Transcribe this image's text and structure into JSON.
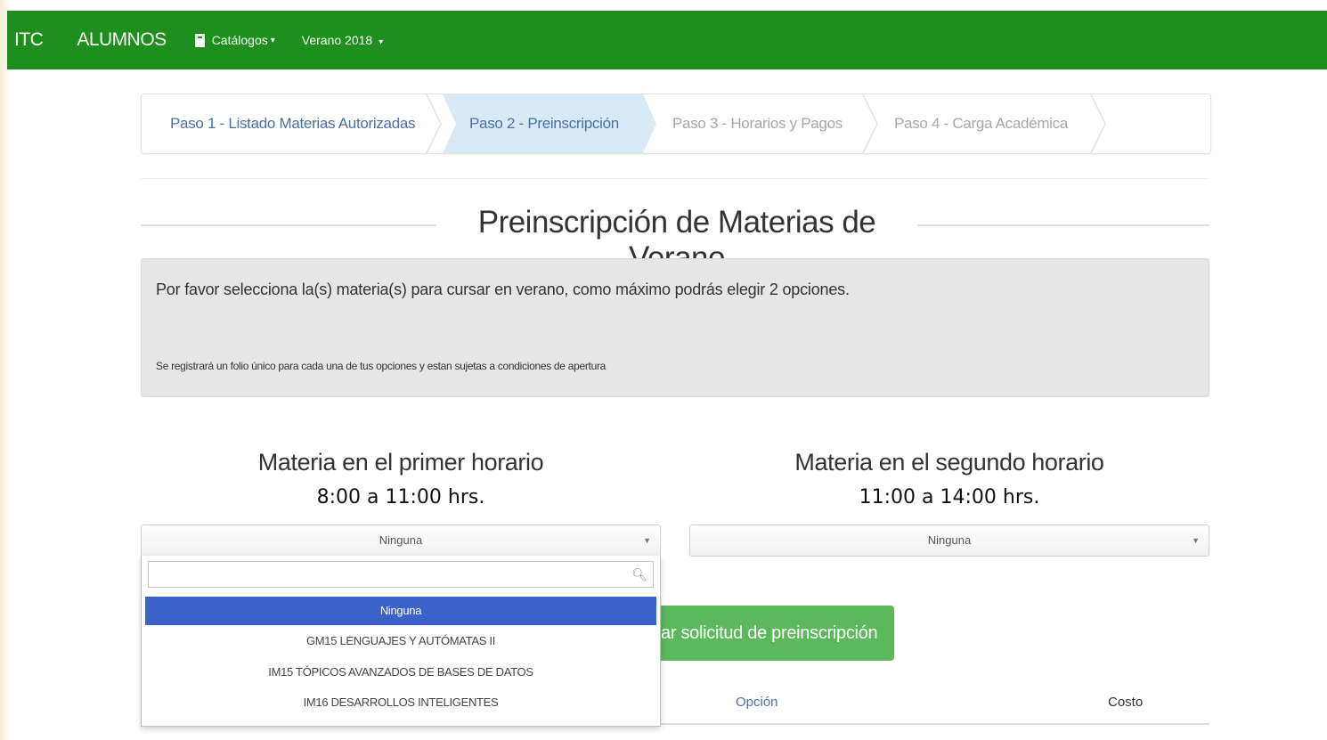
{
  "navbar": {
    "brand": "ITC",
    "alumnos": "ALUMNOS",
    "catalogos": "Catálogos",
    "verano": "Verano 2018",
    "color": "#1e8f1e"
  },
  "steps": [
    {
      "label": "Paso 1 - Listado Materias Autorizadas",
      "state": "done"
    },
    {
      "label": "Paso 2 - Preinscripción",
      "state": "active"
    },
    {
      "label": "Paso 3 - Horarios y Pagos",
      "state": "pending"
    },
    {
      "label": "Paso 4 - Carga Académica",
      "state": "pending"
    }
  ],
  "page_title": "Preinscripción de Materias de Verano",
  "alert": {
    "main": "Por favor selecciona la(s) materia(s) para cursar en verano, como máximo podrás elegir 2 opciones.",
    "note": "Se registrará un folio único para cada una de tus opciones y estan sujetas a condiciones de apertura"
  },
  "first": {
    "title": "Materia en el primer horario",
    "time": "8:00 a 11:00 hrs.",
    "selected": "Ninguna"
  },
  "second": {
    "title": "Materia en el segundo horario",
    "time": "11:00 a 14:00 hrs.",
    "selected": "Ninguna"
  },
  "dropdown": {
    "search_value": "",
    "options": [
      "Ninguna",
      "GM15 LENGUAJES Y AUTÓMATAS II",
      "IM15 TÓPICOS AVANZADOS DE BASES DE DATOS",
      "IM16 DESARROLLOS INTELIGENTES"
    ],
    "selected_index": 0,
    "highlight_color": "#3a62c9"
  },
  "submit_button": "ar solicitud de preinscripción",
  "table": {
    "headers": [
      "Opción",
      "Costo"
    ]
  }
}
